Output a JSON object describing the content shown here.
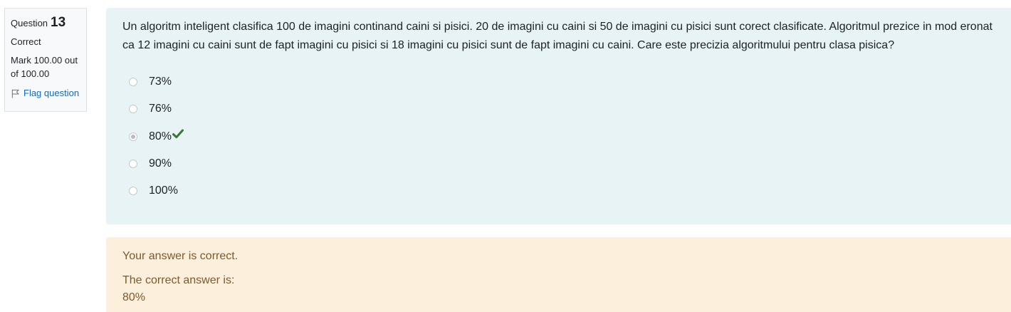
{
  "info": {
    "question_label": "Question",
    "question_number": "13",
    "state": "Correct",
    "grade": "Mark 100.00 out of 100.00",
    "flag_label": "Flag question"
  },
  "question": {
    "text": "Un algoritm inteligent clasifica 100 de imagini continand caini si pisici. 20 de imagini cu caini si 50 de imagini cu pisici sunt corect clasificate. Algoritmul prezice in mod eronat ca 12 imagini cu caini sunt de fapt imagini cu pisici si 18 imagini cu pisici sunt de fapt imagini cu caini. Care este precizia algoritmului pentru clasa pisica?",
    "options": [
      {
        "label": "73%",
        "selected": false
      },
      {
        "label": "76%",
        "selected": false
      },
      {
        "label": "80%",
        "selected": true,
        "correct": true
      },
      {
        "label": "90%",
        "selected": false
      },
      {
        "label": "100%",
        "selected": false
      }
    ]
  },
  "feedback": {
    "general": "Your answer is correct.",
    "right_answer_label": "The correct answer is:",
    "right_answer_value": "80%"
  },
  "colors": {
    "question_bg": "#e7f3f5",
    "feedback_bg": "#fcefdc",
    "feedback_text": "#7d5a29",
    "link": "#0f6cbf",
    "check": "#357a32"
  },
  "icons": {
    "flag": "flag-icon",
    "correct": "check-icon"
  }
}
